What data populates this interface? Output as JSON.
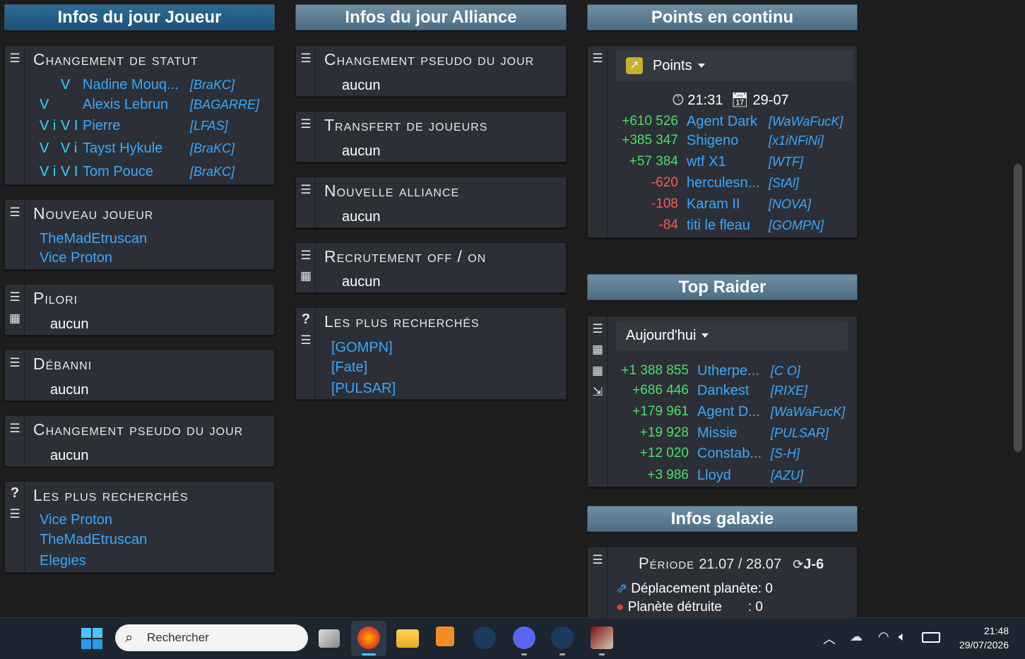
{
  "joueur": {
    "header": "Infos du jour Joueur",
    "statut": {
      "title": "Changement de statut",
      "rows": [
        {
          "f1": "",
          "f2": "V",
          "name": "Nadine Mouq...",
          "tag": "[BraKC]"
        },
        {
          "f1": "V",
          "f2": "",
          "name": "Alexis Lebrun",
          "tag": "[BAGARRE]"
        },
        {
          "f1": "V i",
          "f2": "V I",
          "name": "Pierre",
          "tag": "[LFAS]"
        },
        {
          "f1": "V",
          "f2": "V i",
          "name": "Tayst Hykule",
          "tag": "[BraKC]"
        },
        {
          "f1": "V i",
          "f2": "V I",
          "name": "Tom Pouce",
          "tag": "[BraKC]"
        }
      ]
    },
    "nouveau": {
      "title": "Nouveau joueur",
      "items": [
        "TheMadEtruscan",
        "Vice Proton"
      ]
    },
    "pilori": {
      "title": "Pilori",
      "value": "aucun"
    },
    "debanni": {
      "title": "Débanni",
      "value": "aucun"
    },
    "pseudo": {
      "title": "Changement pseudo du jour",
      "value": "aucun"
    },
    "recherches": {
      "title": "Les plus recherchés",
      "help": "?",
      "items": [
        "Vice Proton",
        "TheMadEtruscan",
        "Elegies"
      ]
    }
  },
  "alliance": {
    "header": "Infos du jour Alliance",
    "pseudo": {
      "title": "Changement pseudo du jour",
      "value": "aucun"
    },
    "transfert": {
      "title": "Transfert de joueurs",
      "value": "aucun"
    },
    "nouvelle": {
      "title": "Nouvelle alliance",
      "value": "aucun"
    },
    "recrutement": {
      "title": "Recrutement off / on",
      "value": "aucun"
    },
    "recherches": {
      "title": "Les plus recherchés",
      "help": "?",
      "items": [
        "[GOMPN]",
        "[Fate]",
        "[PULSAR]"
      ]
    }
  },
  "points": {
    "header": "Points en continu",
    "dropdown": "Points",
    "time": "21:31",
    "date": "29-07",
    "rows": [
      {
        "delta": "+610 526",
        "sign": "pos",
        "name": "Agent Dark",
        "tag": "[WaWaFucK]"
      },
      {
        "delta": "+385 347",
        "sign": "pos",
        "name": "Shigeno",
        "tag": "[x1iNFiNi]"
      },
      {
        "delta": "+57 384",
        "sign": "pos",
        "name": "wtf X1",
        "tag": "[WTF]"
      },
      {
        "delta": "-620",
        "sign": "neg",
        "name": "herculesn...",
        "tag": "[StAl]"
      },
      {
        "delta": "-108",
        "sign": "neg",
        "name": "Karam II",
        "tag": "[NOVA]"
      },
      {
        "delta": "-84",
        "sign": "neg",
        "name": "titi le fleau",
        "tag": "[GOMPN]"
      }
    ]
  },
  "raider": {
    "header": "Top Raider",
    "dropdown": "Aujourd'hui",
    "rows": [
      {
        "delta": "+1 388 855",
        "name": "Utherpe...",
        "tag": "[C O]"
      },
      {
        "delta": "+686 446",
        "name": "Dankest",
        "tag": "[RIXE]"
      },
      {
        "delta": "+179 961",
        "name": "Agent D...",
        "tag": "[WaWaFucK]"
      },
      {
        "delta": "+19 928",
        "name": "Missie",
        "tag": "[PULSAR]"
      },
      {
        "delta": "+12 020",
        "name": "Constab...",
        "tag": "[S-H]"
      },
      {
        "delta": "+3 986",
        "name": "Lloyd",
        "tag": "[AZU]"
      }
    ]
  },
  "galaxie": {
    "header": "Infos galaxie",
    "periode_label": "Période",
    "periode": "21.07 / 28.07",
    "countdown": "J-6",
    "deplacement_label": "Déplacement planète",
    "deplacement": ": 0",
    "detruite_label": "Planète détruite",
    "detruite": ": 0"
  },
  "taskbar": {
    "search_placeholder": "Rechercher",
    "time": "21:48",
    "date": "29/07/2026",
    "icons": [
      "windows-start-icon",
      "task-view-icon",
      "firefox-icon",
      "file-explorer-icon",
      "media-player-icon",
      "steam-icon",
      "discord-icon",
      "steam-icon",
      "game-icon"
    ],
    "colors": {
      "accent": "#3aa7ff",
      "positive": "#4dde6a",
      "negative": "#ff5757"
    }
  }
}
